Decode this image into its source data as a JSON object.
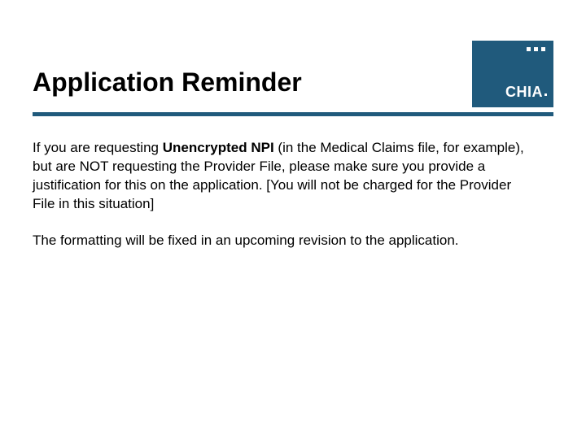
{
  "title": "Application Reminder",
  "logo": {
    "text": "CHIA"
  },
  "paragraph1": {
    "prefix": "If you are requesting ",
    "bold": "Unencrypted NPI",
    "suffix": " (in the Medical Claims file, for example), but are NOT requesting the Provider File, please make sure you provide a justification for this on the application. [You will not be charged for the Provider File in this situation]"
  },
  "paragraph2": "The formatting will be fixed in an upcoming revision to the application."
}
